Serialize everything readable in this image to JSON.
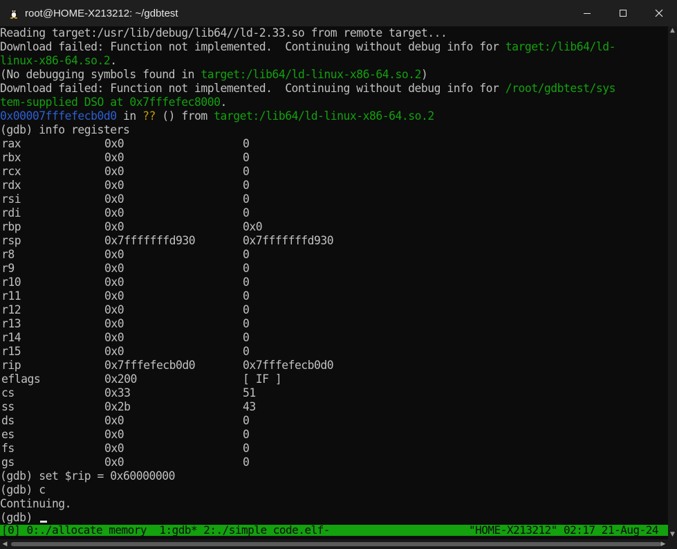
{
  "window": {
    "title": "root@HOME-X213212: ~/gdbtest",
    "controls": {
      "minimize": "—",
      "maximize": "☐",
      "close": "✕"
    }
  },
  "terminal": {
    "intro": [
      {
        "segments": [
          {
            "text": "Reading target:/usr/lib/debug/lib64//ld-2.33.so from remote target...",
            "color": "default"
          }
        ]
      },
      {
        "segments": [
          {
            "text": "Download failed: Function not implemented.  Continuing without debug info for ",
            "color": "default"
          },
          {
            "text": "target:/lib64/ld-",
            "color": "green"
          }
        ]
      },
      {
        "segments": [
          {
            "text": "linux-x86-64.so.2",
            "color": "green"
          },
          {
            "text": ".",
            "color": "default"
          }
        ]
      },
      {
        "segments": [
          {
            "text": "(No debugging symbols found in ",
            "color": "default"
          },
          {
            "text": "target:/lib64/ld-linux-x86-64.so.2",
            "color": "green"
          },
          {
            "text": ")",
            "color": "default"
          }
        ]
      },
      {
        "segments": [
          {
            "text": "Download failed: Function not implemented.  Continuing without debug info for ",
            "color": "default"
          },
          {
            "text": "/root/gdbtest/sys",
            "color": "green"
          }
        ]
      },
      {
        "segments": [
          {
            "text": "tem-supplied DSO at 0x7fffefec8000",
            "color": "green"
          },
          {
            "text": ".",
            "color": "default"
          }
        ]
      },
      {
        "segments": [
          {
            "text": "0x00007fffefecb0d0",
            "color": "blue"
          },
          {
            "text": " in ",
            "color": "default"
          },
          {
            "text": "??",
            "color": "yellow"
          },
          {
            "text": " () from ",
            "color": "default"
          },
          {
            "text": "target:/lib64/ld-linux-x86-64.so.2",
            "color": "green"
          }
        ]
      },
      {
        "segments": [
          {
            "text": "(gdb) info registers",
            "color": "default"
          }
        ]
      }
    ],
    "registers": [
      {
        "name": "rax",
        "hex": "0x0",
        "natural": "0"
      },
      {
        "name": "rbx",
        "hex": "0x0",
        "natural": "0"
      },
      {
        "name": "rcx",
        "hex": "0x0",
        "natural": "0"
      },
      {
        "name": "rdx",
        "hex": "0x0",
        "natural": "0"
      },
      {
        "name": "rsi",
        "hex": "0x0",
        "natural": "0"
      },
      {
        "name": "rdi",
        "hex": "0x0",
        "natural": "0"
      },
      {
        "name": "rbp",
        "hex": "0x0",
        "natural": "0x0"
      },
      {
        "name": "rsp",
        "hex": "0x7fffffffd930",
        "natural": "0x7fffffffd930"
      },
      {
        "name": "r8",
        "hex": "0x0",
        "natural": "0"
      },
      {
        "name": "r9",
        "hex": "0x0",
        "natural": "0"
      },
      {
        "name": "r10",
        "hex": "0x0",
        "natural": "0"
      },
      {
        "name": "r11",
        "hex": "0x0",
        "natural": "0"
      },
      {
        "name": "r12",
        "hex": "0x0",
        "natural": "0"
      },
      {
        "name": "r13",
        "hex": "0x0",
        "natural": "0"
      },
      {
        "name": "r14",
        "hex": "0x0",
        "natural": "0"
      },
      {
        "name": "r15",
        "hex": "0x0",
        "natural": "0"
      },
      {
        "name": "rip",
        "hex": "0x7fffefecb0d0",
        "natural": "0x7fffefecb0d0"
      },
      {
        "name": "eflags",
        "hex": "0x200",
        "natural": "[ IF ]"
      },
      {
        "name": "cs",
        "hex": "0x33",
        "natural": "51"
      },
      {
        "name": "ss",
        "hex": "0x2b",
        "natural": "43"
      },
      {
        "name": "ds",
        "hex": "0x0",
        "natural": "0"
      },
      {
        "name": "es",
        "hex": "0x0",
        "natural": "0"
      },
      {
        "name": "fs",
        "hex": "0x0",
        "natural": "0"
      },
      {
        "name": "gs",
        "hex": "0x0",
        "natural": "0"
      }
    ],
    "after": [
      "(gdb) set $rip = 0x60000000",
      "(gdb) c",
      "Continuing."
    ],
    "prompt": "(gdb) "
  },
  "statusbar": {
    "left": "[0] 0:./allocate_memory  1:gdb* 2:./simple_code.elf-",
    "right": "\"HOME-X213212\" 02:17 21-Aug-24"
  },
  "colors": {
    "background": "#0c0c0c",
    "text": "#c0c0c0",
    "green": "#13a10e",
    "blue": "#2d5fd0",
    "yellow": "#c19c00",
    "statusbar_bg": "#13a10e"
  },
  "icons": {
    "app": "tux-icon",
    "minimize": "minimize-icon",
    "maximize": "maximize-icon",
    "close": "close-icon"
  }
}
